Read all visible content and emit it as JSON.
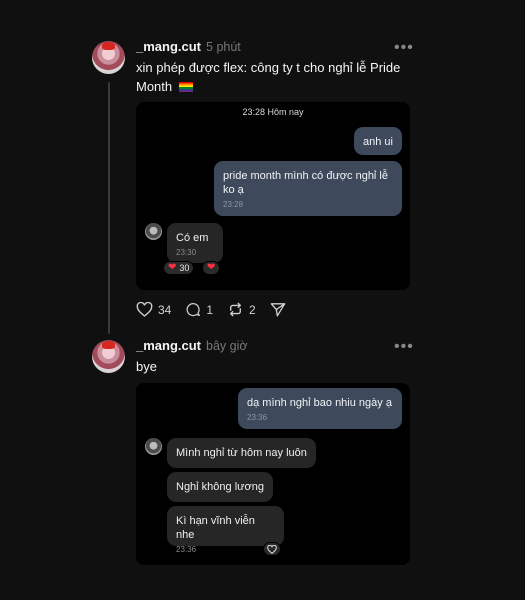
{
  "post1": {
    "username": "_mang.cut",
    "time": "5 phút",
    "caption": "xin phép được flex: công ty t cho nghỉ lễ Pride Month",
    "flag_icon": "rainbow-flag-icon",
    "screenshot": {
      "timestamp": "23:28 Hôm nay",
      "messages": [
        {
          "text": "anh ui",
          "time": ""
        },
        {
          "text": "pride month mình có được nghỉ lễ ko ạ",
          "time": "23:28"
        },
        {
          "text": "Có em",
          "time": "23:30"
        }
      ],
      "reaction_count": "30"
    },
    "actions": {
      "likes": "34",
      "replies": "1",
      "reposts": "2"
    }
  },
  "post2": {
    "username": "_mang.cut",
    "time": "bây giờ",
    "caption": "bye",
    "screenshot": {
      "messages": [
        {
          "text": "dạ mình nghỉ bao nhiu ngày ạ",
          "time": "23:36"
        },
        {
          "text": "Mình nghỉ từ hôm nay luôn",
          "time": ""
        },
        {
          "text": "Nghỉ không lương",
          "time": ""
        },
        {
          "text": "Kì hạn vĩnh viễn nhe",
          "time": "23:36"
        }
      ]
    }
  },
  "colors": {
    "background": "#101010",
    "outgoing_bubble": "#3e4a5b",
    "incoming_bubble": "#262626",
    "heart": "#ff3040"
  }
}
